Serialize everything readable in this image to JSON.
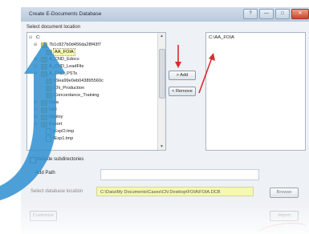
{
  "window": {
    "title": "Create E-Documents Database",
    "buttons": [
      "?",
      "—",
      "□",
      "✕"
    ]
  },
  "labels": {
    "select_location": "Select document location",
    "include_sub": "Include subdirectories",
    "add_path": "Add Path",
    "db_location": "Select database location"
  },
  "tree": {
    "items": [
      {
        "label": "C:",
        "exp": "⊟",
        "icon": "drive"
      },
      {
        "label": "7b1c827b0d456da28f43f7",
        "exp": "⊞",
        "icon": "folder"
      },
      {
        "label": "AA_FOIA",
        "exp": "",
        "icon": "folder",
        "selected": true
      },
      {
        "label": "A_CND_Edocs",
        "exp": "⊞",
        "icon": "folder"
      },
      {
        "label": "A_CND_LeadFile",
        "exp": "⊞",
        "icon": "folder"
      },
      {
        "label": "A_CND_PSTs",
        "exp": "⊞",
        "icon": "folder"
      },
      {
        "label": "b9ea99e0eb043895560c",
        "exp": "",
        "icon": "folder"
      },
      {
        "label": "CN_Production",
        "exp": "",
        "icon": "folder"
      },
      {
        "label": "Concordance_Training",
        "exp": "",
        "icon": "folder"
      },
      {
        "label": "Data",
        "exp": "⊞",
        "icon": "folder"
      },
      {
        "label": "Dell",
        "exp": "⊞",
        "icon": "folder"
      },
      {
        "label": "Deploy",
        "exp": "⊞",
        "icon": "folder"
      },
      {
        "label": "Export",
        "exp": "⊞",
        "icon": "folder"
      },
      {
        "label": "IExpO.tmp",
        "exp": "",
        "icon": "file"
      },
      {
        "label": "IExp1.tmp",
        "exp": "",
        "icon": "file"
      }
    ]
  },
  "buttons": {
    "add": "> Add",
    "remove": "< Remove",
    "browse": "Browse",
    "customize": "Customize",
    "import": "Import"
  },
  "selected_docs": [
    "C:\\AA_FOIA"
  ],
  "fields": {
    "add_path_value": "",
    "db_location_value": "C:\\Data\\My Documents\\Cases\\CN Desktop\\FOIA\\FOIA.DCB"
  },
  "colors": {
    "highlight_yellow": "#f4f8b0",
    "annotation_arrow": "#2e8fd0",
    "red_arrow": "#d92d2d"
  }
}
